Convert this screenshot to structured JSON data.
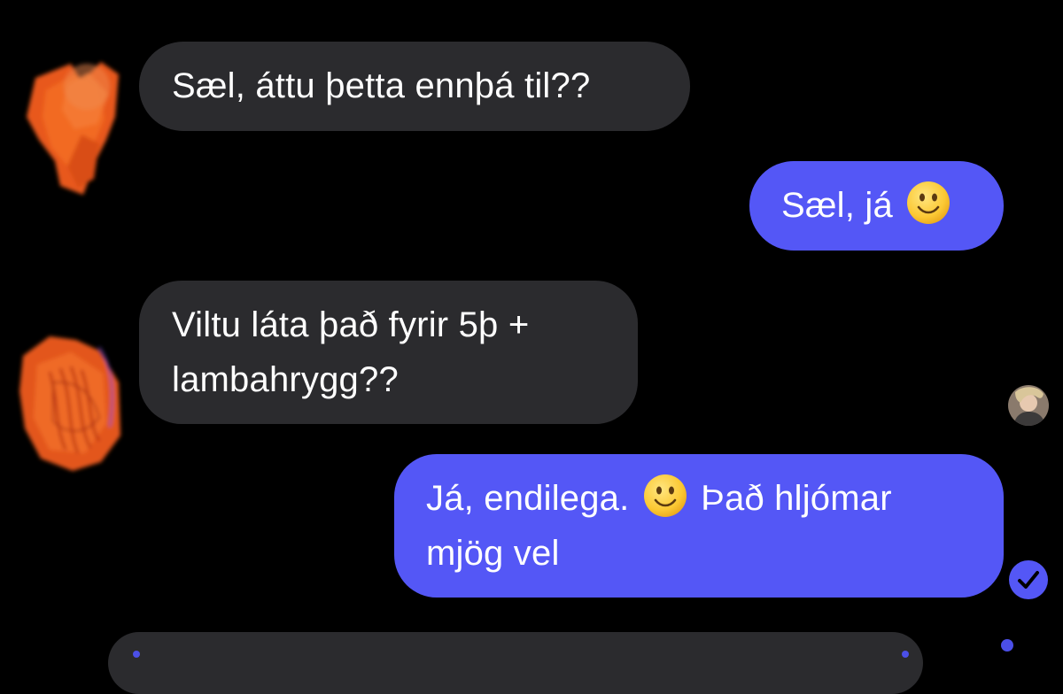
{
  "conversation": {
    "messages": [
      {
        "direction": "incoming",
        "lines": [
          "Sæl, áttu þetta ennþá til??"
        ]
      },
      {
        "direction": "outgoing",
        "lines": [
          "Sæl, já"
        ],
        "emoji": "slightly-smiling-face"
      },
      {
        "direction": "incoming",
        "lines": [
          "Viltu láta það fyrir 5þ +",
          "lambahrygg??"
        ]
      },
      {
        "direction": "outgoing",
        "lines": [
          "Já, endilega.",
          "Það hljómar",
          "mjög vel"
        ],
        "emoji": "slightly-smiling-face"
      }
    ],
    "status": {
      "seen_avatar": "seen-avatar",
      "delivered_icon": "check-circle-icon"
    }
  },
  "composer": {
    "input_value": ""
  },
  "colors": {
    "background": "#000000",
    "incoming_bubble": "#2b2b2e",
    "outgoing_bubble": "#5457f6",
    "text": "#ffffff"
  }
}
